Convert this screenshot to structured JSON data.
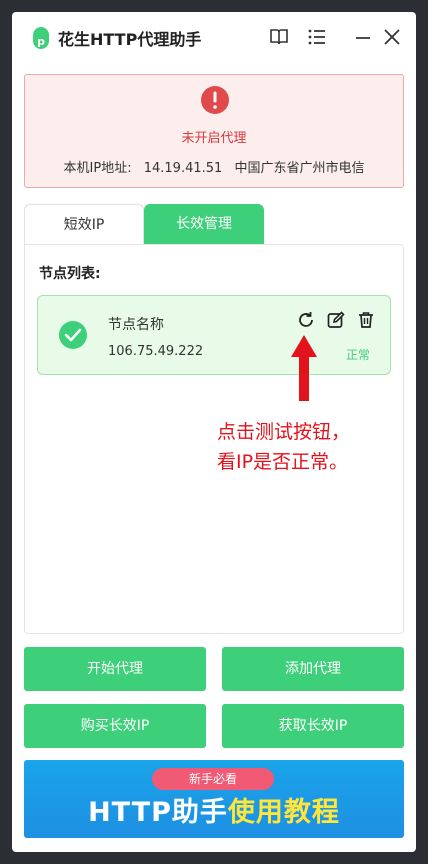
{
  "app": {
    "title": "花生HTTP代理助手"
  },
  "status": {
    "text": "未开启代理",
    "ip_label": "本机IP地址:",
    "ip_value": "14.19.41.51",
    "location": "中国广东省广州市电信"
  },
  "tabs": [
    {
      "label": "短效IP",
      "active": false
    },
    {
      "label": "长效管理",
      "active": true
    }
  ],
  "node_list": {
    "title": "节点列表:",
    "nodes": [
      {
        "name": "节点名称",
        "ip": "106.75.49.222",
        "status": "正常"
      }
    ]
  },
  "annotation": {
    "line1": "点击测试按钮，",
    "line2": "看IP是否正常。"
  },
  "buttons": {
    "start_proxy": "开始代理",
    "add_proxy": "添加代理",
    "buy_long_ip": "购买长效IP",
    "get_long_ip": "获取长效IP"
  },
  "banner": {
    "badge": "新手必看",
    "main": "HTTP助手",
    "highlight": "使用教程"
  },
  "colors": {
    "accent": "#3ecf7a",
    "alert": "#e04a4a",
    "annotation": "#e3121b"
  }
}
